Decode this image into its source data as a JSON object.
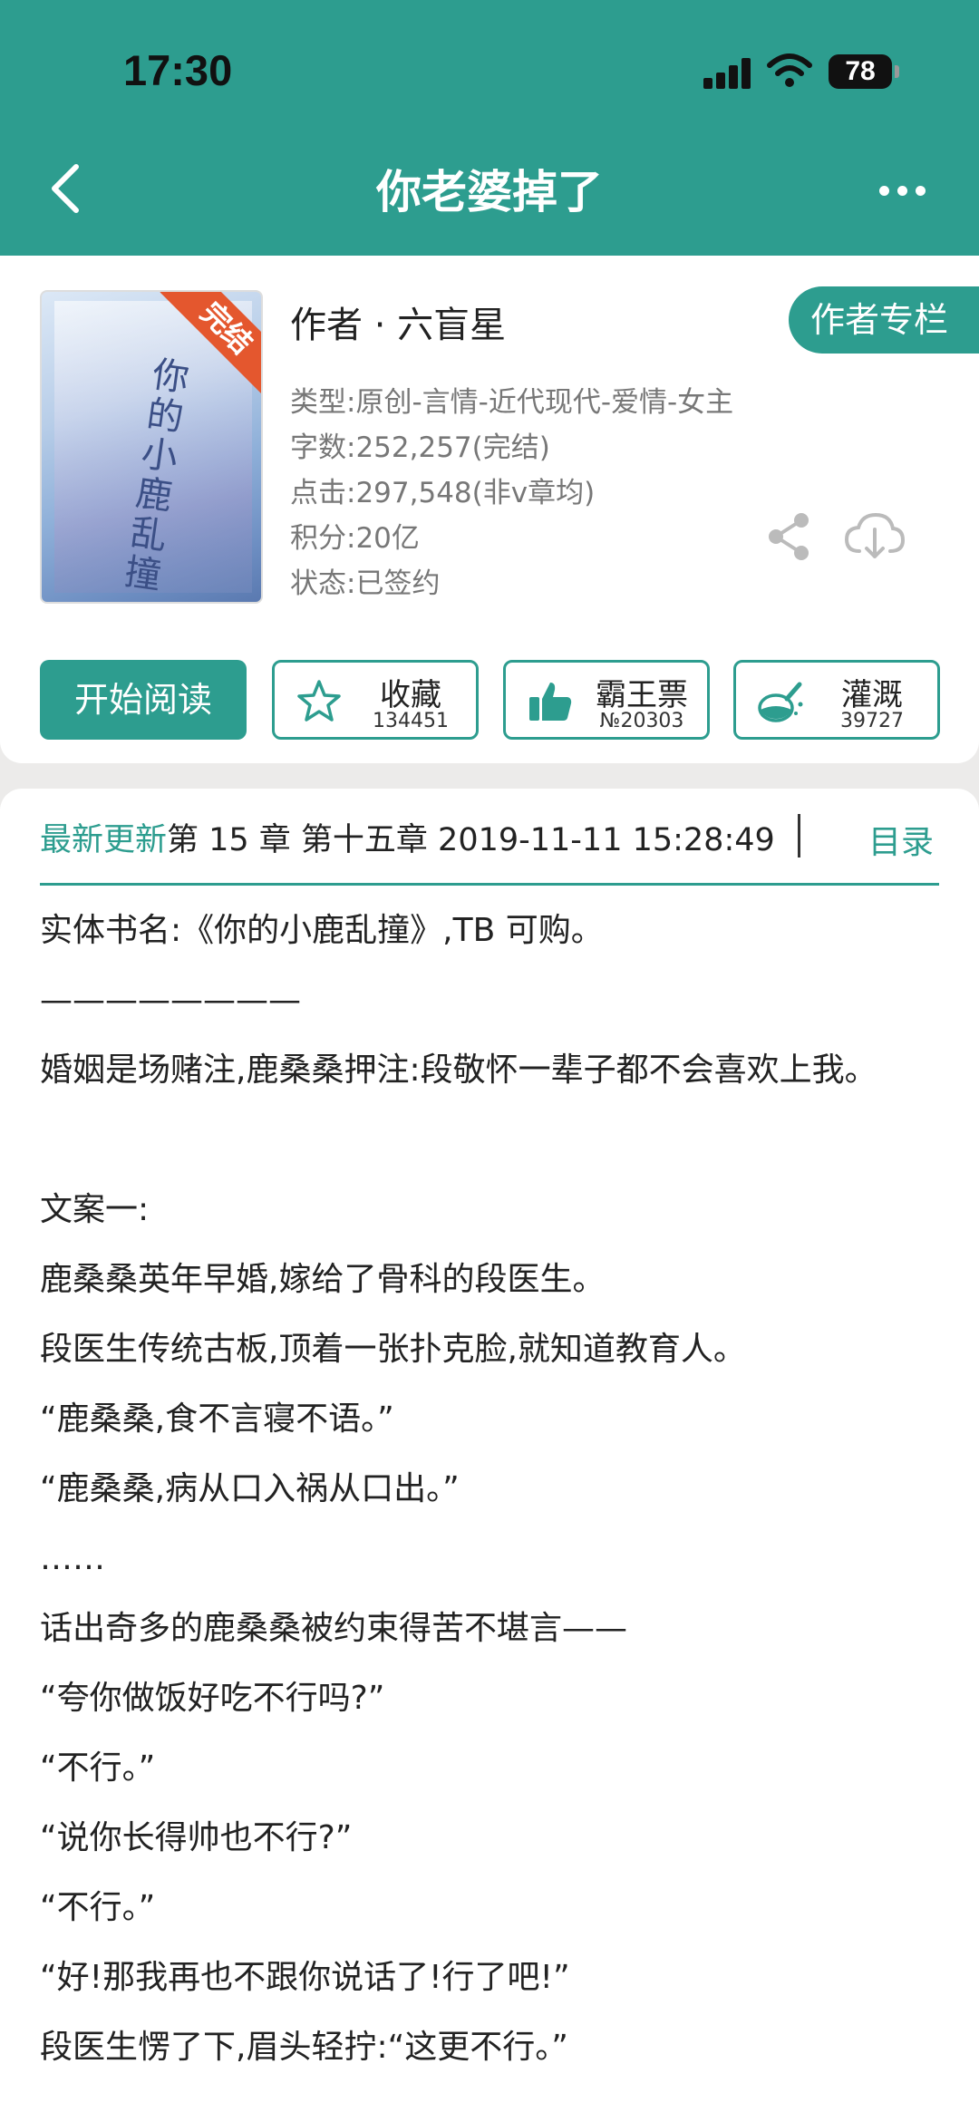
{
  "status_bar": {
    "time": "17:30",
    "battery": "78"
  },
  "nav": {
    "title": "你老婆掉了"
  },
  "book": {
    "cover_title": "你的小鹿乱撞",
    "cover_badge": "完结",
    "author_line": "作者 · 六盲星",
    "author_column_button": "作者专栏",
    "meta": [
      "类型:原创-言情-近代现代-爱情-女主",
      "字数:252,257(完结)",
      "点击:297,548(非v章均)",
      "积分:20亿",
      "状态:已签约"
    ]
  },
  "actions": {
    "start_reading": "开始阅读",
    "favorite": {
      "label": "收藏",
      "count": "134451",
      "icon": "star-icon"
    },
    "vote": {
      "label": "霸王票",
      "count": "№20303",
      "icon": "thumbs-up-icon"
    },
    "water": {
      "label": "灌溉",
      "count": "39727",
      "icon": "watering-flask-icon"
    }
  },
  "latest_update": {
    "label": "最新更新",
    "text": "第 15 章 第十五章 2019-11-11 15:28:49",
    "toc": "目录"
  },
  "description": [
    "实体书名:《你的小鹿乱撞》,TB 可购。",
    "————————",
    "婚姻是场赌注,鹿桑桑押注:段敬怀一辈子都不会喜欢上我。",
    "",
    "文案一:",
    "鹿桑桑英年早婚,嫁给了骨科的段医生。",
    "段医生传统古板,顶着一张扑克脸,就知道教育人。",
    "“鹿桑桑,食不言寝不语。”",
    "“鹿桑桑,病从口入祸从口出。”",
    "……",
    "话出奇多的鹿桑桑被约束得苦不堪言——",
    "“夸你做饭好吃不行吗?”",
    "“不行。”",
    "“说你长得帅也不行?”",
    "“不行。”",
    "“好!那我再也不跟你说话了!行了吧!”",
    "段医生愣了下,眉头轻拧:“这更不行。”"
  ],
  "colors": {
    "accent": "#2d9d8f",
    "badge": "#e4572e"
  }
}
